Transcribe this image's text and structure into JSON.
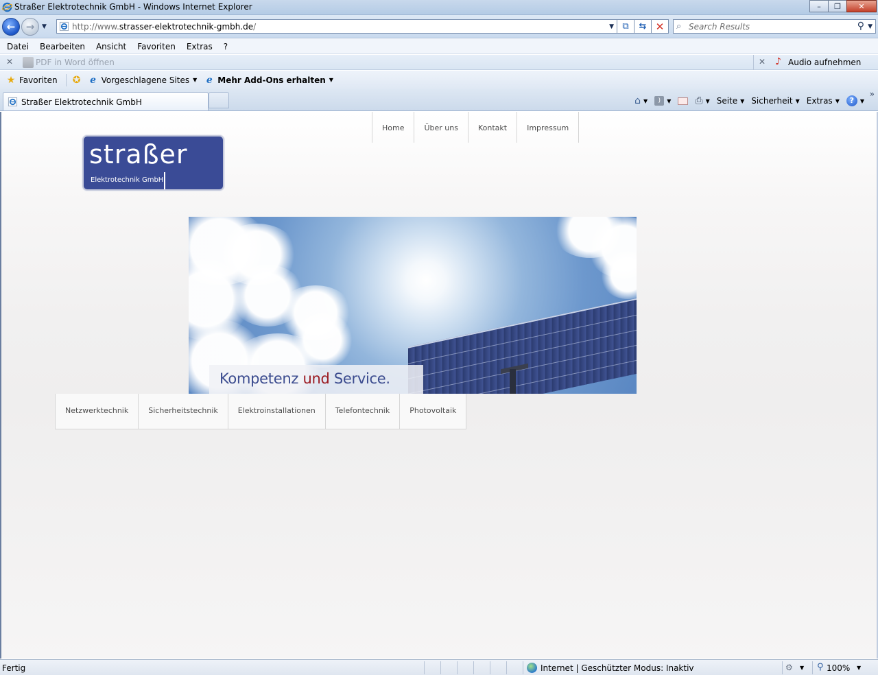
{
  "window": {
    "title": "Straßer Elektrotechnik GmbH - Windows Internet Explorer",
    "minimize": "–",
    "maximize": "❐",
    "close": "✕"
  },
  "address": {
    "url_prefix": "http://www.",
    "url_domain": "strasser-elektrotechnik-gmbh.de",
    "url_suffix": "/",
    "search_placeholder": "Search Results"
  },
  "menu": {
    "items": [
      "Datei",
      "Bearbeiten",
      "Ansicht",
      "Favoriten",
      "Extras",
      "?"
    ]
  },
  "addon_bar": {
    "pdf_label": "PDF in Word öffnen",
    "audio_label": "Audio aufnehmen"
  },
  "favorites_bar": {
    "favorites_label": "Favoriten",
    "suggested_label": "Vorgeschlagene Sites",
    "addons_label": "Mehr Add-Ons erhalten"
  },
  "tabs": {
    "active_label": "Straßer Elektrotechnik GmbH"
  },
  "command_bar": {
    "page_label": "Seite",
    "safety_label": "Sicherheit",
    "tools_label": "Extras",
    "more": "»"
  },
  "site": {
    "top_nav": [
      "Home",
      "Über uns",
      "Kontakt",
      "Impressum"
    ],
    "logo_word": "straßer",
    "logo_sub": "Elektrotechnik GmbH",
    "slogan_part1": "Kompetenz ",
    "slogan_und": "und",
    "slogan_part2": " Service.",
    "sub_nav": [
      "Netzwerktechnik",
      "Sicherheitstechnik",
      "Elektroinstallationen",
      "Telefontechnik",
      "Photovoltaik"
    ],
    "colors": {
      "brand_blue": "#3a4b96",
      "slogan_blue": "#3c4c8f",
      "slogan_red": "#9b1a21"
    }
  },
  "status": {
    "text": "Fertig",
    "zone": "Internet | Geschützter Modus: Inaktiv",
    "zoom": "100%"
  },
  "icons": {
    "back": "back-arrow-icon",
    "forward": "forward-arrow-icon",
    "search": "magnifier-icon",
    "home": "home-icon",
    "feeds": "rss-feed-icon",
    "mail": "mail-icon",
    "print": "printer-icon",
    "help": "help-icon"
  }
}
